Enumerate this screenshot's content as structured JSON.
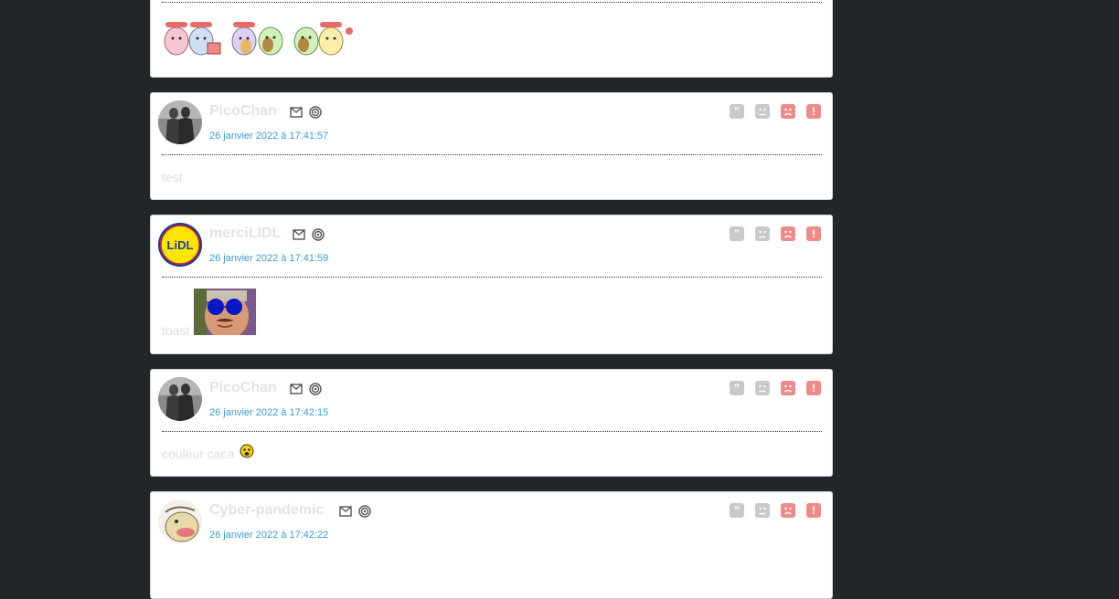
{
  "posts": [
    {
      "username": "",
      "date": "",
      "content": ""
    },
    {
      "username": "PicoChan",
      "date": "26 janvier 2022 à 17:41:57",
      "content": "test"
    },
    {
      "username": "merciLIDL",
      "date": "26 janvier 2022 à 17:41:59",
      "content": "toast",
      "avatar_text": "LiDL"
    },
    {
      "username": "PicoChan",
      "date": "26 janvier 2022 à 17:42:15",
      "content": "couleur caca"
    },
    {
      "username": "Cyber-pandemic",
      "date": "26 janvier 2022 à 17:42:22",
      "content": ""
    }
  ],
  "icons": {
    "message": "envelope-icon",
    "spiral": "spiral-icon",
    "quote": "quote-icon",
    "sad": "sad-face-icon",
    "angry": "angry-face-icon",
    "report": "report-icon"
  },
  "actions": {
    "quote_glyph": "”",
    "report_glyph": "!"
  },
  "colors": {
    "background": "#22252a",
    "card": "#ffffff",
    "date": "#3d9ad6",
    "action_grey": "#c9c9c9",
    "action_red": "#f08a8a"
  }
}
